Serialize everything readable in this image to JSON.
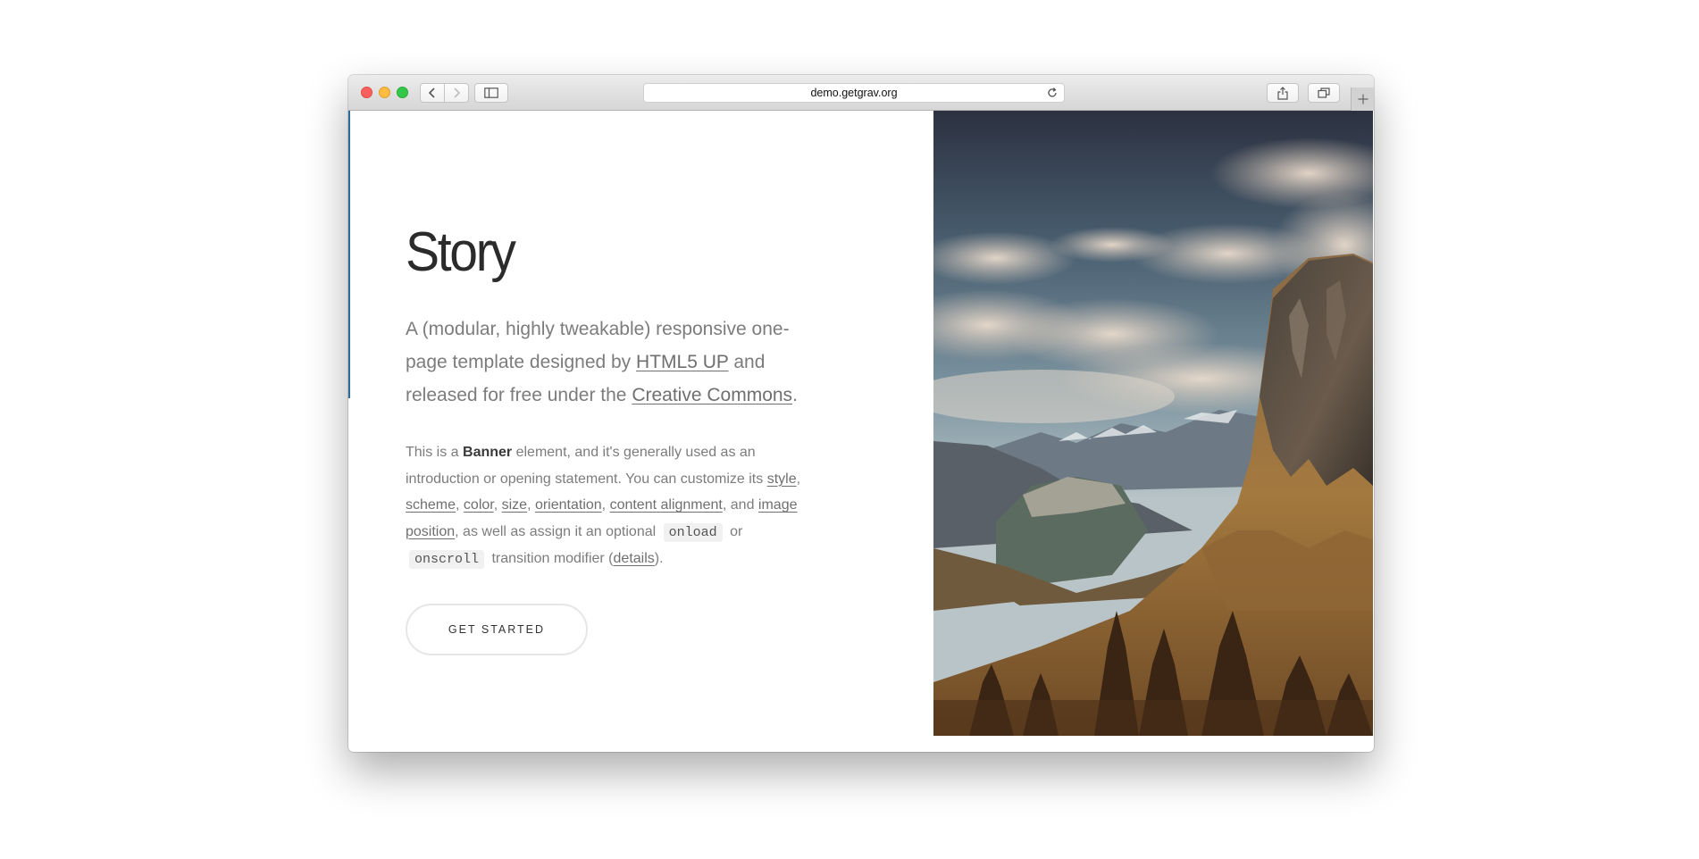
{
  "browser": {
    "url": "demo.getgrav.org"
  },
  "banner": {
    "title": "Story",
    "subtitle": {
      "text1": "A (modular, highly tweakable) responsive one-page template designed by ",
      "link1": "HTML5 UP",
      "text2": " and released for free under the ",
      "link2": "Creative Commons",
      "text3": "."
    },
    "description": {
      "t1": "This is a ",
      "bold": "Banner",
      "t2": " element, and it's generally used as an introduction or opening statement. You can customize its ",
      "l_style": "style",
      "s1": ", ",
      "l_scheme": "scheme",
      "s2": ", ",
      "l_color": "color",
      "s3": ", ",
      "l_size": "size",
      "s4": ", ",
      "l_orientation": "orientation",
      "s5": ", ",
      "l_content_alignment": "content alignment",
      "s6": ", and ",
      "l_image_position": "image position",
      "t3": ", as well as assign it an optional ",
      "code_onload": "onload",
      "t4": " or ",
      "code_onscroll": "onscroll",
      "t5": " transition modifier (",
      "l_details": "details",
      "t6": ")."
    },
    "cta_label": "GET STARTED"
  },
  "colors": {
    "toolbar": "#dcdcdc",
    "title_text": "#2b2b2b",
    "body_text": "#7c7c7c",
    "button_border": "#e6e6e6"
  }
}
